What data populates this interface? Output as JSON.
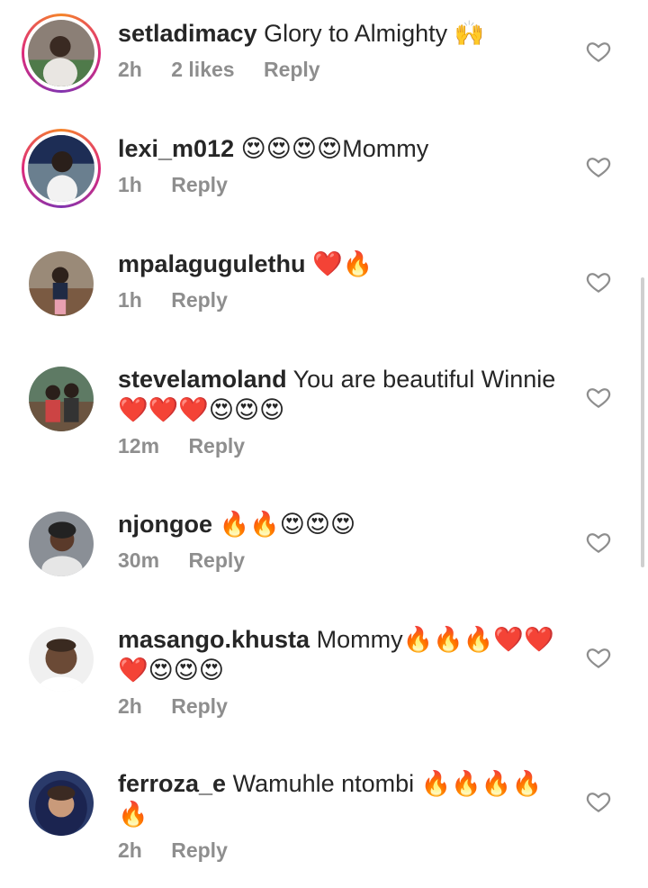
{
  "comments": [
    {
      "username": "setladimacy",
      "text": "Glory to Almighty 🙌",
      "time": "2h",
      "likes": "2 likes",
      "reply": "Reply"
    },
    {
      "username": "lexi_m012",
      "text": "😍😍😍😍Mommy",
      "time": "1h",
      "reply": "Reply"
    },
    {
      "username": "mpalagugulethu",
      "text": "❤️🔥",
      "time": "1h",
      "reply": "Reply"
    },
    {
      "username": "stevelamoland",
      "text": "You are beautiful Winnie ❤️❤️❤️😍😍😍",
      "time": "12m",
      "reply": "Reply"
    },
    {
      "username": "njongoe",
      "text": "🔥🔥😍😍😍",
      "time": "30m",
      "reply": "Reply"
    },
    {
      "username": "masango.khusta",
      "text": "Mommy🔥🔥🔥❤️❤️❤️😍😍😍",
      "time": "2h",
      "reply": "Reply"
    },
    {
      "username": "ferroza_e",
      "text": "Wamuhle ntombi 🔥🔥🔥🔥🔥",
      "time": "2h",
      "reply": "Reply"
    }
  ],
  "colors": {
    "text": "#262626",
    "meta": "#8e8e8e",
    "story_ring": "#dd2a7b"
  },
  "icons": {
    "like": "heart-outline-icon"
  }
}
